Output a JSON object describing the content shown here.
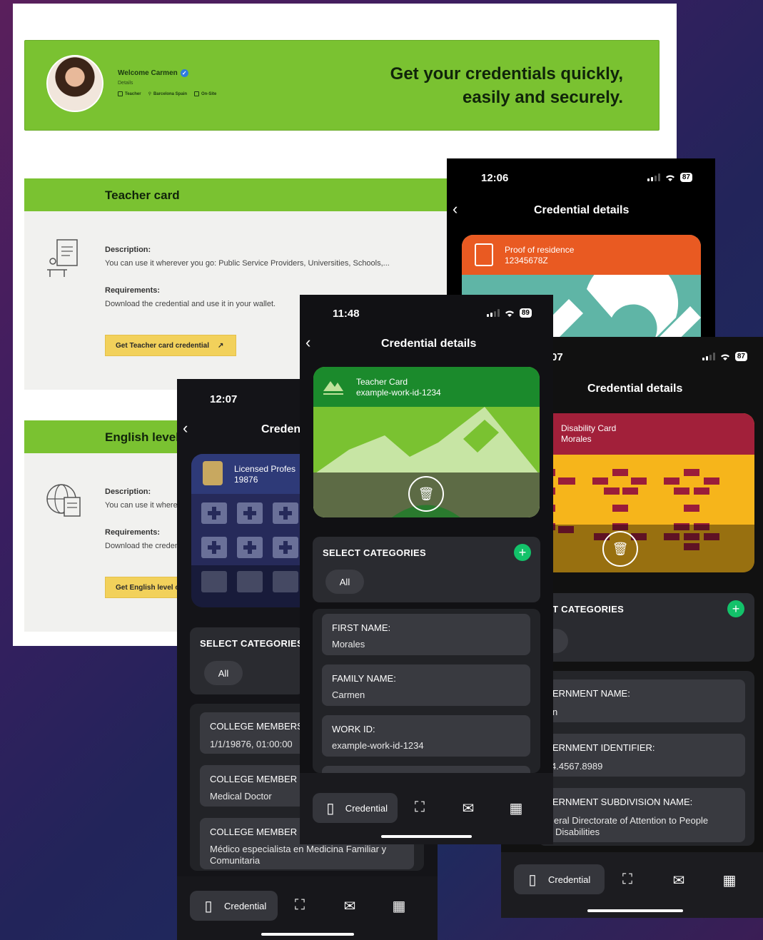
{
  "web": {
    "banner": {
      "welcome": "Welcome Carmen",
      "details": "Details",
      "meta": [
        "Teacher",
        "Barcelona Spain",
        "On-Site"
      ],
      "slogan_line1": "Get your credentials quickly,",
      "slogan_line2": "easily and securely."
    },
    "teacher_card": {
      "title": "Teacher card",
      "description_label": "Description:",
      "description": "You can use it wherever you go: Public Service Providers, Universities, Schools,...",
      "requirements_label": "Requirements:",
      "requirements": "Download the credential and use it in your wallet.",
      "button": "Get Teacher card credential"
    },
    "english_card": {
      "title": "English level",
      "description_label": "Description:",
      "description": "You can use it wherever you go: Public Service Providers, Universities, Schools,...",
      "requirements_label": "Requirements:",
      "requirements": "Download the credential and use it in your wallet.",
      "button": "Get English level credential"
    }
  },
  "phone_residence": {
    "time": "12:06",
    "battery": "87",
    "title": "Credential details",
    "card_line1": "Proof of residence",
    "card_line2": "12345678Z"
  },
  "phone_teacher": {
    "time": "11:48",
    "battery": "89",
    "title": "Credential details",
    "card_line1": "Teacher Card",
    "card_line2": "example-work-id-1234",
    "categories_title": "SELECT CATEGORIES",
    "category_all": "All",
    "fields": [
      {
        "label": "FIRST NAME:",
        "value": "Morales"
      },
      {
        "label": "FAMILY NAME:",
        "value": "Carmen"
      },
      {
        "label": "WORK ID:",
        "value": "example-work-id-1234"
      }
    ],
    "tab_credential": "Credential"
  },
  "phone_disability": {
    "time": "07",
    "battery": "87",
    "title": "Credential details",
    "card_line1": "Disability Card",
    "card_line2": "Morales",
    "categories_title": "T CATEGORIES",
    "fields": [
      {
        "label": "ERNMENT NAME:",
        "value": "n"
      },
      {
        "label": "ERNMENT IDENTIFIER:",
        "value": "4.4567.8989"
      },
      {
        "label": "ERNMENT SUBDIVISION NAME:",
        "value": "eral Directorate of Attention to People",
        "value2": "Disabilities"
      }
    ],
    "tab_credential": "Credential"
  },
  "phone_licensed": {
    "time": "12:07",
    "title": "Creden",
    "card_line1": "Licensed Profes",
    "card_line2": "19876",
    "categories_title": "SELECT CATEGORIES",
    "category_all": "All",
    "fields": [
      {
        "label": "COLLEGE MEMBERS",
        "value": "1/1/19876, 01:00:00"
      },
      {
        "label": "COLLEGE MEMBER R",
        "value": "Medical Doctor"
      },
      {
        "label": "COLLEGE MEMBER S",
        "value": "Médico especialista en Medicina Familiar y",
        "value2": "Comunitaria"
      }
    ],
    "tab_credential": "Credential"
  }
}
